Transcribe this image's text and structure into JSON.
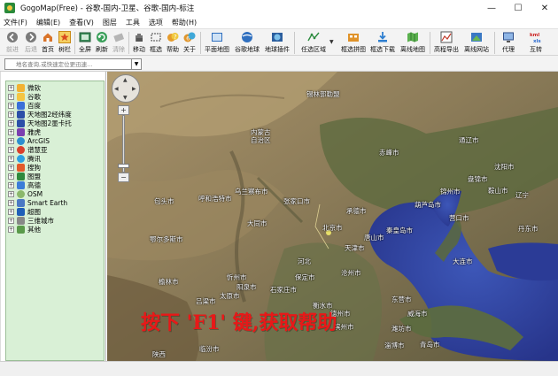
{
  "window": {
    "title": "GogoMap(Free) - 谷歌-国内-卫星、谷歌-国内-标注",
    "minimize": "—",
    "maximize": "☐",
    "close": "✕"
  },
  "menu": [
    "文件(F)",
    "编辑(E)",
    "查看(V)",
    "图层",
    "工具",
    "选项",
    "帮助(H)"
  ],
  "toolbar": {
    "back": "前进",
    "forward": "后退",
    "home": "首页",
    "tree": "树栏",
    "fullscreen": "全屏",
    "refresh": "刷新",
    "clear": "清除",
    "move": "移动",
    "select": "框选",
    "help": "帮助",
    "about": "关于",
    "flatmap": "平面地图",
    "google_earth": "谷歌地球",
    "earth_plugin": "地球插件",
    "any_region": "任选区域",
    "select_mosaic": "框选拼图",
    "select_download": "框选下载",
    "offline_map": "离线地图",
    "elevation_export": "高程导出",
    "offline_site": "离线网站",
    "proxy": "代理",
    "interchange": "互转"
  },
  "search": {
    "placeholder": "地名查询,或快速定位更迅速..."
  },
  "tree": [
    {
      "label": "微软",
      "color": "#f2b233"
    },
    {
      "label": "谷歌",
      "color": "#f4c542"
    },
    {
      "label": "百度",
      "color": "#3a6fd8"
    },
    {
      "label": "天地图2经纬度",
      "color": "#2b4fa8"
    },
    {
      "label": "天地图2墨卡托",
      "color": "#2b4fa8"
    },
    {
      "label": "雅虎",
      "color": "#7b3fb0"
    },
    {
      "label": "ArcGIS",
      "color": "#2c8fcf"
    },
    {
      "label": "谱慧亚",
      "color": "#d9402c"
    },
    {
      "label": "腾讯",
      "color": "#2da1e3"
    },
    {
      "label": "搜狗",
      "color": "#e35a2a"
    },
    {
      "label": "图盟",
      "color": "#2f8a3d"
    },
    {
      "label": "高德",
      "color": "#3b7dd8"
    },
    {
      "label": "OSM",
      "color": "#8ab86b"
    },
    {
      "label": "Smart Earth",
      "color": "#4a79c4"
    },
    {
      "label": "超图",
      "color": "#1f5fb8"
    },
    {
      "label": "三维城市",
      "color": "#888888"
    },
    {
      "label": "其他",
      "color": "#5a9a4a"
    }
  ],
  "map": {
    "places": [
      "内蒙古",
      "自治区",
      "锡林郭勒盟",
      "赤峰市",
      "沈阳市",
      "辽宁",
      "锦州市",
      "鞍山市",
      "盘锦市",
      "葫芦岛市",
      "营口市",
      "大连市",
      "丹东市",
      "承德市",
      "秦皇岛市",
      "张家口市",
      "北京市",
      "天津市",
      "唐山市",
      "乌兰察布市",
      "呼和浩特市",
      "大同市",
      "包头市",
      "鄂尔多斯市",
      "保定市",
      "沧州市",
      "河北",
      "石家庄市",
      "忻州市",
      "太原市",
      "阳泉市",
      "衡水市",
      "德州市",
      "榆林市",
      "吕梁市",
      "朝阳市",
      "滨州市",
      "东营市",
      "淄博市",
      "潍坊市",
      "烟台市",
      "威海市",
      "青岛市",
      "济南市",
      "陕西",
      "临汾市",
      "通辽市",
      "长治市",
      "山西",
      "朔州市"
    ],
    "help_text": "按下 'F1' 键,获取帮助"
  }
}
